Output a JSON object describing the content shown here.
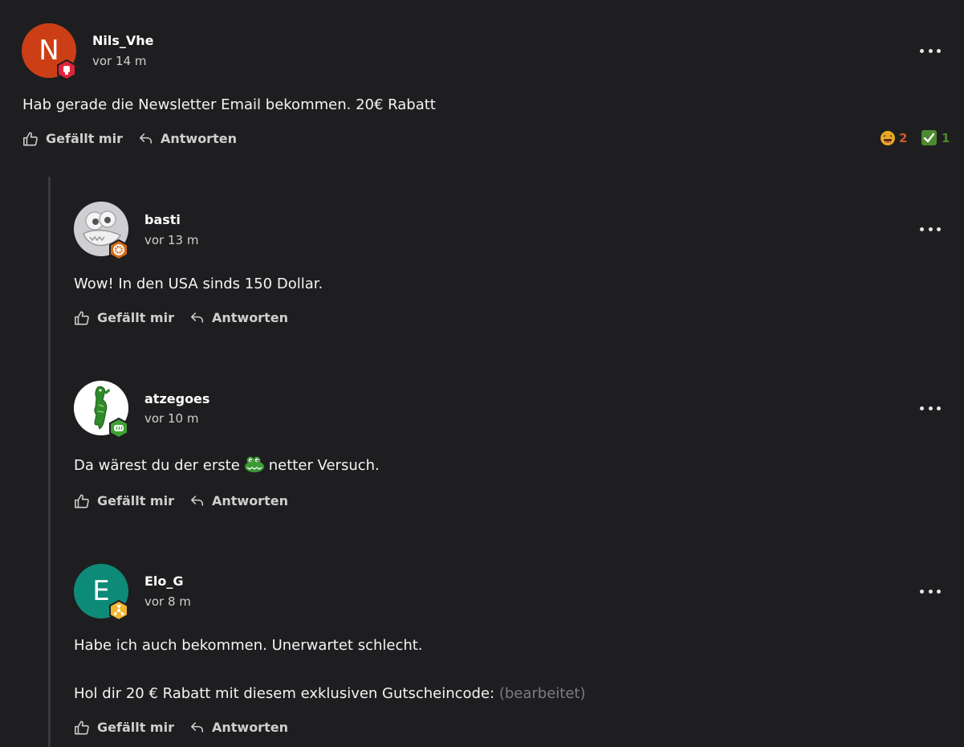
{
  "comments": [
    {
      "username": "Nils_Vhe",
      "time": "vor 14 m",
      "avatar_letter": "N",
      "avatar_color": "#cc3f16",
      "badge_color": "#e0243b",
      "text": "Hab gerade die Newsletter Email bekommen. 20€ Rabatt",
      "like_label": "Gefällt mir",
      "reply_label": "Antworten",
      "reactions": [
        {
          "icon": "laughing-face-icon",
          "count": "2",
          "color": "#cc5b2c"
        },
        {
          "icon": "check-mark-icon",
          "count": "1",
          "color": "#4d8a2f"
        }
      ]
    },
    {
      "username": "basti",
      "time": "vor 13 m",
      "avatar_image": "crocodile-avatar",
      "badge_color": "#d36b16",
      "text": "Wow! In den USA sinds 150 Dollar.",
      "like_label": "Gefällt mir",
      "reply_label": "Antworten"
    },
    {
      "username": "atzegoes",
      "time": "vor 10 m",
      "avatar_image": "green-crocodile-avatar",
      "badge_color": "#3fa235",
      "text_before": "Da wärest du der erste",
      "text_after": "netter Versuch.",
      "like_label": "Gefällt mir",
      "reply_label": "Antworten"
    },
    {
      "username": "Elo_G",
      "time": "vor 8 m",
      "avatar_letter": "E",
      "avatar_color": "#0d8a78",
      "badge_color": "#f2b533",
      "text_line1": "Habe ich auch bekommen. Unerwartet schlecht.",
      "text_line2": "Hol dir 20 € Rabatt mit diesem exklusiven Gutscheincode:",
      "edited": "(bearbeitet)",
      "like_label": "Gefällt mir",
      "reply_label": "Antworten"
    }
  ]
}
